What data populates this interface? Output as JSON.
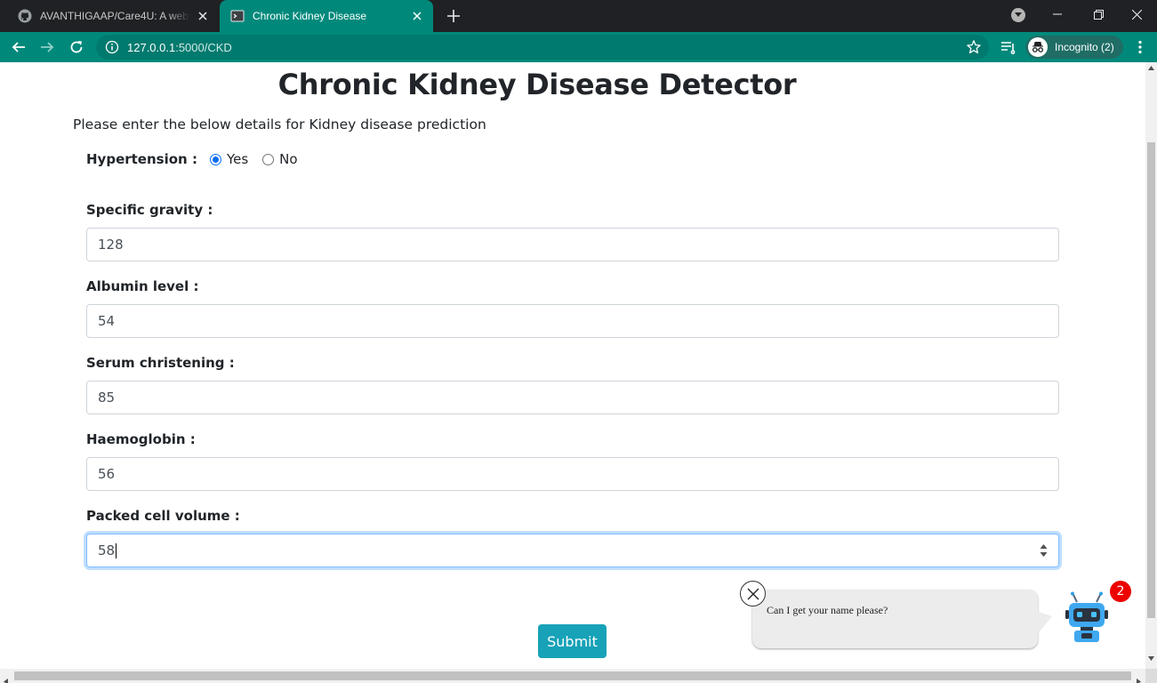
{
  "browser": {
    "tabs": [
      {
        "title": "AVANTHIGAAP/Care4U: A website",
        "icon": "github-icon",
        "active": false
      },
      {
        "title": "Chronic Kidney Disease",
        "icon": "terminal-icon",
        "active": true
      }
    ],
    "address": {
      "host": "127.0.0.1",
      "path": ":5000/CKD"
    },
    "profile_label": "Incognito (2)",
    "accent_color": "#00897b"
  },
  "page": {
    "title": "Chronic Kidney Disease Detector",
    "intro": "Please enter the below details for Kidney disease prediction",
    "hypertension": {
      "label": "Hypertension :",
      "options": [
        "Yes",
        "No"
      ],
      "selected": "Yes"
    },
    "fields": [
      {
        "label": "Specific gravity :",
        "value": "128"
      },
      {
        "label": "Albumin level :",
        "value": "54"
      },
      {
        "label": "Serum christening :",
        "value": "85"
      },
      {
        "label": "Haemoglobin :",
        "value": "56"
      },
      {
        "label": "Packed cell volume :",
        "value": "58"
      }
    ],
    "submit_label": "Submit",
    "submit_color": "#17a2b8"
  },
  "chatbot": {
    "message": "Can I get your name please?",
    "badge_count": "2",
    "badge_color": "#ee0000"
  }
}
